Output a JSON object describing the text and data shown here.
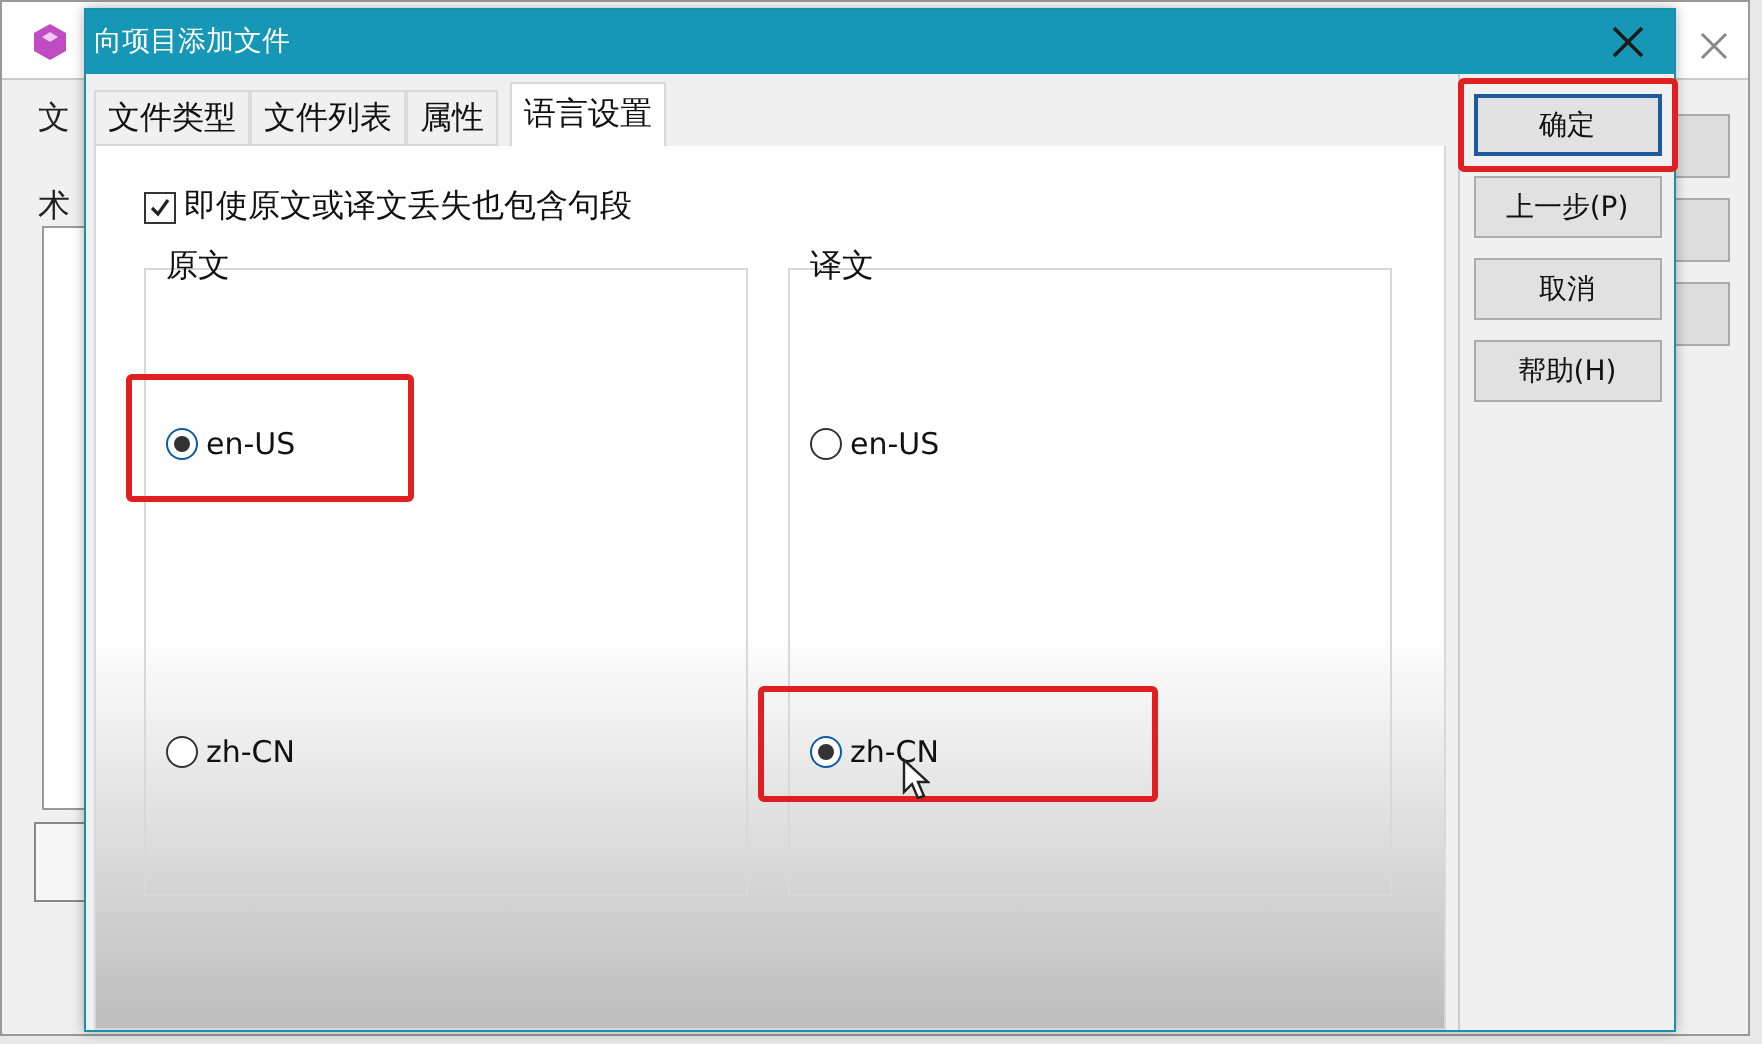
{
  "background_window": {
    "tab_fragment": "文",
    "label_fragment": "术"
  },
  "dialog": {
    "title": "向项目添加文件"
  },
  "tabs": [
    {
      "label": "文件类型",
      "selected": false
    },
    {
      "label": "文件列表",
      "selected": false
    },
    {
      "label": "属性",
      "selected": false
    },
    {
      "label": "语言设置",
      "selected": true
    }
  ],
  "include_option": {
    "label": "即使原文或译文丢失也包含句段",
    "checked": true
  },
  "groups": [
    {
      "title": "原文",
      "options": [
        {
          "label": "en-US",
          "selected": true,
          "highlighted": true
        },
        {
          "label": "zh-CN",
          "selected": false,
          "highlighted": false
        }
      ]
    },
    {
      "title": "译文",
      "options": [
        {
          "label": "en-US",
          "selected": false,
          "highlighted": false
        },
        {
          "label": "zh-CN",
          "selected": true,
          "highlighted": true
        }
      ]
    }
  ],
  "buttons": [
    {
      "label": "确定",
      "default": true,
      "highlighted": true
    },
    {
      "label": "上一步(P)",
      "default": false,
      "highlighted": false
    },
    {
      "label": "取消",
      "default": false,
      "highlighted": false
    },
    {
      "label": "帮助(H)",
      "default": false,
      "highlighted": false
    }
  ]
}
